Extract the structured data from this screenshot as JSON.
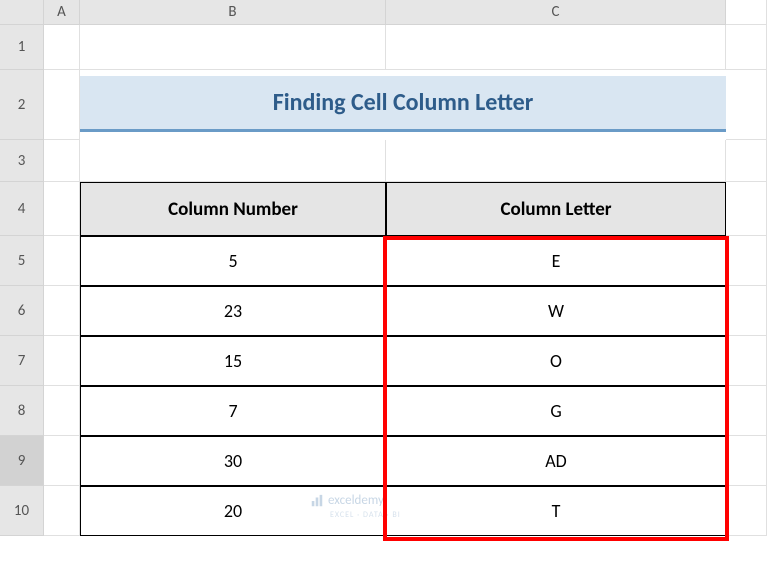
{
  "columns": [
    "A",
    "B",
    "C"
  ],
  "rows": [
    "1",
    "2",
    "3",
    "4",
    "5",
    "6",
    "7",
    "8",
    "9",
    "10"
  ],
  "title": "Finding Cell Column Letter",
  "headers": {
    "column_number": "Column Number",
    "column_letter": "Column Letter"
  },
  "data": [
    {
      "column_number": "5",
      "column_letter": "E"
    },
    {
      "column_number": "23",
      "column_letter": "W"
    },
    {
      "column_number": "15",
      "column_letter": "O"
    },
    {
      "column_number": "7",
      "column_letter": "G"
    },
    {
      "column_number": "30",
      "column_letter": "AD"
    },
    {
      "column_number": "20",
      "column_letter": "T"
    }
  ],
  "watermark": {
    "text": "exceldemy",
    "subtext": "EXCEL · DATA · BI"
  },
  "chart_data": {
    "type": "table",
    "title": "Finding Cell Column Letter",
    "columns": [
      "Column Number",
      "Column Letter"
    ],
    "rows": [
      [
        5,
        "E"
      ],
      [
        23,
        "W"
      ],
      [
        15,
        "O"
      ],
      [
        7,
        "G"
      ],
      [
        30,
        "AD"
      ],
      [
        20,
        "T"
      ]
    ]
  }
}
